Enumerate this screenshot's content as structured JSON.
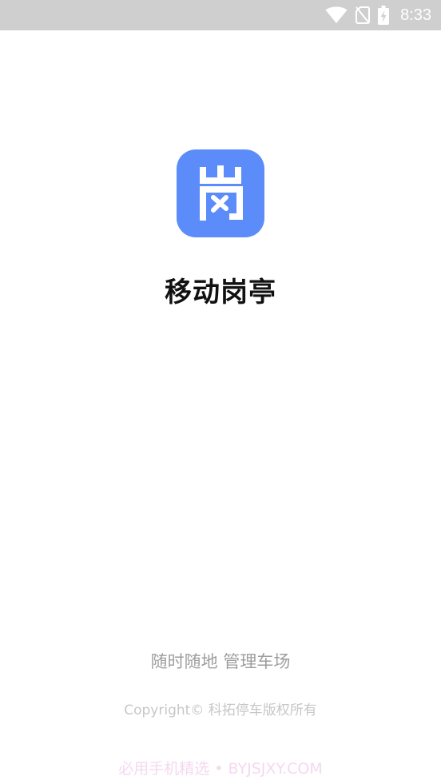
{
  "status_bar": {
    "time": "8:33",
    "icons": [
      "wifi-icon",
      "no-sim-icon",
      "battery-charging-icon"
    ]
  },
  "splash": {
    "logo_icon": "gang-character-logo-icon",
    "logo_color": "#5b8cf9",
    "app_name": "移动岗亭",
    "slogan": "随时随地 管理车场",
    "copyright": "Copyright© 科拓停车版权所有"
  },
  "watermark": {
    "text": "必用手机精选 • BYJSJXY.COM"
  }
}
